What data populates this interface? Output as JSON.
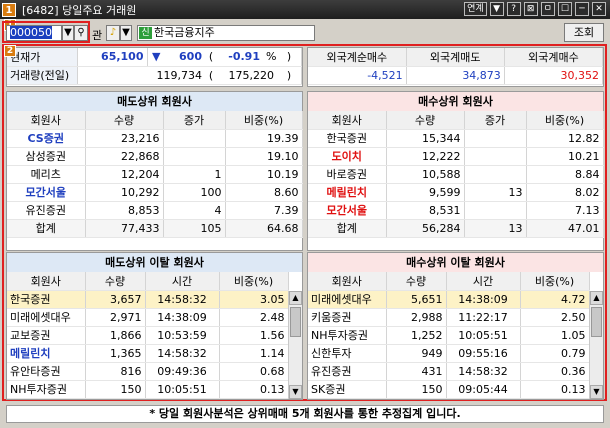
{
  "title": {
    "num": "1",
    "text": "[6482] 당일주요 거래원"
  },
  "title_buttons": [
    "연계",
    "▼",
    "?",
    "⊠",
    "ㅁ",
    "☐",
    "─",
    "✕"
  ],
  "toolbar": {
    "num": "1",
    "code": "000050",
    "gwan": "관",
    "sin": "신",
    "name": "한국금융지주",
    "lookup": "조회"
  },
  "section2_num": "2",
  "quote": {
    "label_price": "현재가",
    "price": "65,100",
    "arrow": "▼",
    "change": "600",
    "open1": "(",
    "change_pct": "-0.91",
    "pct": "%",
    "close1": ")",
    "label_vol": "거래량(전일)",
    "volume": "119,734",
    "open2": "(",
    "prev_volume": "175,220",
    "close2": ")"
  },
  "foreign": {
    "headers": [
      "외국계순매수",
      "외국계매도",
      "외국계매수"
    ],
    "values": [
      "-4,521",
      "34,873",
      "30,352"
    ]
  },
  "sell_top": {
    "title": "매도상위 회원사",
    "headers": [
      "회원사",
      "수량",
      "증가",
      "비중(%)"
    ],
    "rows": [
      [
        "CS증권",
        "23,216",
        "",
        "19.39"
      ],
      [
        "삼성증권",
        "22,868",
        "",
        "19.10"
      ],
      [
        "메리츠",
        "12,204",
        "1",
        "10.19"
      ],
      [
        "모간서울",
        "10,292",
        "100",
        "8.60"
      ],
      [
        "유진증권",
        "8,853",
        "4",
        "7.39"
      ],
      [
        "합계",
        "77,433",
        "105",
        "64.68"
      ]
    ]
  },
  "buy_top": {
    "title": "매수상위 회원사",
    "headers": [
      "회원사",
      "수량",
      "증가",
      "비중(%)"
    ],
    "rows": [
      [
        "한국증권",
        "15,344",
        "",
        "12.82"
      ],
      [
        "도이치",
        "12,222",
        "",
        "10.21"
      ],
      [
        "바로증권",
        "10,588",
        "",
        "8.84"
      ],
      [
        "메릴린치",
        "9,599",
        "13",
        "8.02"
      ],
      [
        "모간서울",
        "8,531",
        "",
        "7.13"
      ],
      [
        "합계",
        "56,284",
        "13",
        "47.01"
      ]
    ]
  },
  "sell_detail": {
    "title": "매도상위 이탈 회원사",
    "headers": [
      "회원사",
      "수량",
      "시간",
      "비중(%)"
    ],
    "rows": [
      [
        "한국증권",
        "3,657",
        "14:58:32",
        "3.05"
      ],
      [
        "미래에셋대우",
        "2,971",
        "14:38:09",
        "2.48"
      ],
      [
        "교보증권",
        "1,866",
        "10:53:59",
        "1.56"
      ],
      [
        "메릴린치",
        "1,365",
        "14:58:32",
        "1.14"
      ],
      [
        "유안타증권",
        "816",
        "09:49:36",
        "0.68"
      ],
      [
        "NH투자증권",
        "150",
        "10:05:51",
        "0.13"
      ]
    ]
  },
  "buy_detail": {
    "title": "매수상위 이탈 회원사",
    "headers": [
      "회원사",
      "수량",
      "시간",
      "비중(%)"
    ],
    "rows": [
      [
        "미래에셋대우",
        "5,651",
        "14:38:09",
        "4.72"
      ],
      [
        "키움증권",
        "2,988",
        "11:22:17",
        "2.50"
      ],
      [
        "NH투자증권",
        "1,252",
        "10:05:51",
        "1.05"
      ],
      [
        "신한투자",
        "949",
        "09:55:16",
        "0.79"
      ],
      [
        "유진증권",
        "431",
        "14:58:32",
        "0.36"
      ],
      [
        "SK증권",
        "150",
        "09:05:44",
        "0.13"
      ]
    ]
  },
  "footer": "* 당일 회원사분석은 상위매매 5개 회원사를 통한 추정집계 입니다.",
  "colors": {
    "accent_red": "#e02020",
    "blue_text": "#1f3fbf",
    "sell_header": "#dde8f5",
    "buy_header": "#fbe4e4",
    "selected_row": "#fdf2c6"
  }
}
